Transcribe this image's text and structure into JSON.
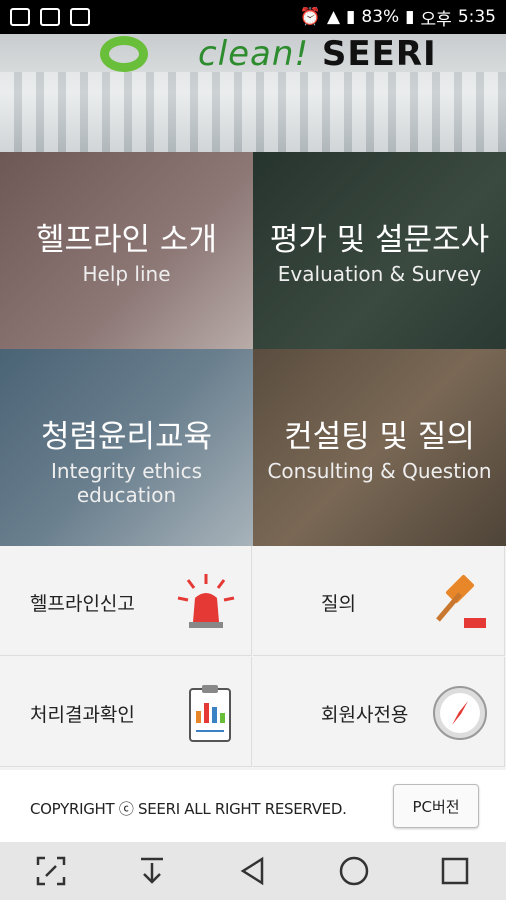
{
  "status": {
    "battery": "83%",
    "ampm": "오후",
    "time": "5:35"
  },
  "logo": {
    "word1": "clean!",
    "word2": "SEERI"
  },
  "tiles": [
    {
      "ko": "헬프라인 소개",
      "en": "Help line"
    },
    {
      "ko": "평가 및 설문조사",
      "en": "Evaluation & Survey"
    },
    {
      "ko": "청렴윤리교육",
      "en": "Integrity ethics education"
    },
    {
      "ko": "컨설팅 및 질의",
      "en": "Consulting & Question"
    }
  ],
  "menu": [
    {
      "label": "헬프라인신고",
      "icon": "siren-icon"
    },
    {
      "label": "질의",
      "icon": "gavel-icon"
    },
    {
      "label": "처리결과확인",
      "icon": "clipboard-chart-icon"
    },
    {
      "label": "회원사전용",
      "icon": "compass-icon"
    }
  ],
  "footer": {
    "copyright": "COPYRIGHT ⓒ SEERI ALL RIGHT RESERVED.",
    "pc_button": "PC버전"
  },
  "colors": {
    "logo_green": "#6abf3a",
    "siren_red": "#e53935",
    "gavel_orange": "#e8872a"
  }
}
